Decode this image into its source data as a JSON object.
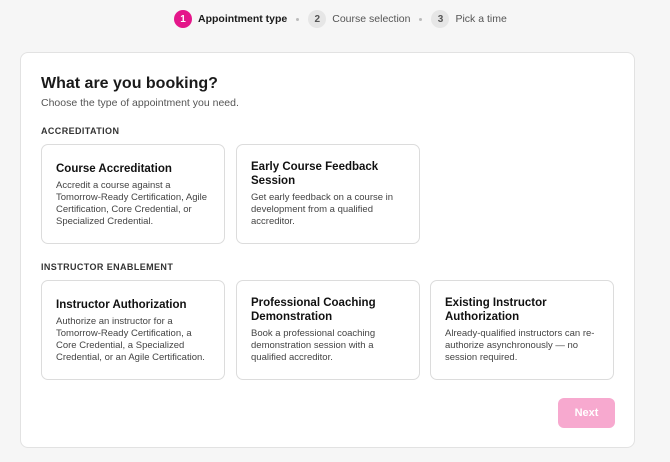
{
  "stepper": {
    "steps": [
      {
        "number": "1",
        "label": "Appointment type"
      },
      {
        "number": "2",
        "label": "Course selection"
      },
      {
        "number": "3",
        "label": "Pick a time"
      }
    ]
  },
  "booking": {
    "title": "What are you booking?",
    "subtitle": "Choose the type of appointment you need.",
    "sections": [
      {
        "label": "ACCREDITATION",
        "options": [
          {
            "title": "Course Accreditation",
            "description": "Accredit a course against a Tomorrow-Ready Certification, Agile Certification, Core Credential, or Specialized Credential."
          },
          {
            "title": "Early Course Feedback Session",
            "description": "Get early feedback on a course in development from a qualified accreditor."
          }
        ]
      },
      {
        "label": "INSTRUCTOR ENABLEMENT",
        "options": [
          {
            "title": "Instructor Authorization",
            "description": "Authorize an instructor for a Tomorrow-Ready Certification, a Core Credential, a Specialized Credential, or an Agile Certification."
          },
          {
            "title": "Professional Coaching Demonstration",
            "description": "Book a professional coaching demonstration session with a qualified accreditor."
          },
          {
            "title": "Existing Instructor Authorization",
            "description": "Already-qualified instructors can re-authorize asynchronously — no session required."
          }
        ]
      }
    ],
    "next_label": "Next"
  },
  "colors": {
    "accent": "#e4168a",
    "next_disabled": "#f7a9cf"
  }
}
